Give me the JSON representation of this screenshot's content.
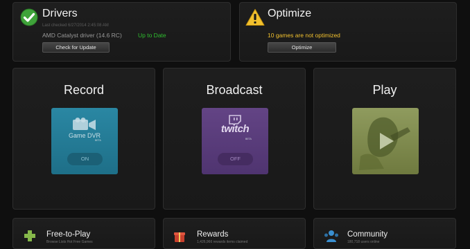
{
  "drivers": {
    "title": "Drivers",
    "last_checked": "Last checked 6/27/2014 2:45:08 AM",
    "driver_name": "AMD Catalyst driver (14.6 RC)",
    "status": "Up to Date",
    "check_button": "Check for Update",
    "status_color": "#2fbf2f"
  },
  "optimize": {
    "title": "Optimize",
    "message": "10 games are not optimized",
    "button": "Optimize",
    "message_color": "#f2c12e"
  },
  "cards": {
    "record": {
      "title": "Record",
      "tile_label": "Game DVR",
      "badge": "BETA",
      "toggle": "ON"
    },
    "broadcast": {
      "title": "Broadcast",
      "tile_label": "twitch",
      "badge": "BETA",
      "toggle": "OFF"
    },
    "play": {
      "title": "Play"
    }
  },
  "bottom": {
    "free": {
      "title": "Free-to-Play",
      "sub": "Browse Lists   Hot Free Games"
    },
    "rewards": {
      "title": "Rewards",
      "sub": "1,426,966 rewards items claimed"
    },
    "community": {
      "title": "Community",
      "sub": "180,718 users online"
    }
  }
}
